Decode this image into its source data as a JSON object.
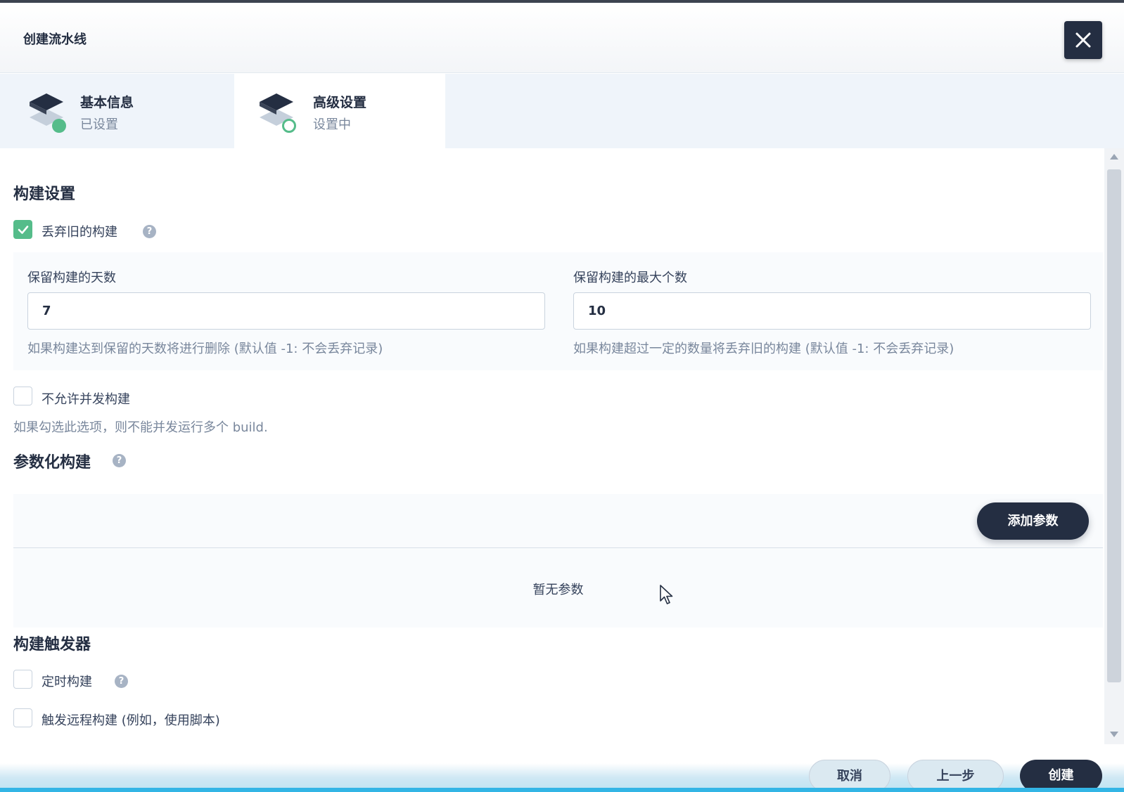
{
  "dialog": {
    "title": "创建流水线"
  },
  "steps": [
    {
      "title": "基本信息",
      "status": "已设置"
    },
    {
      "title": "高级设置",
      "status": "设置中"
    }
  ],
  "build_settings": {
    "title": "构建设置",
    "discard_old": {
      "label": "丢弃旧的构建",
      "checked": true
    },
    "days": {
      "label": "保留构建的天数",
      "value": "7",
      "hint": "如果构建达到保留的天数将进行删除 (默认值 -1: 不会丢弃记录)"
    },
    "max": {
      "label": "保留构建的最大个数",
      "value": "10",
      "hint": "如果构建超过一定的数量将丢弃旧的构建 (默认值 -1: 不会丢弃记录)"
    },
    "no_concurrent": {
      "label": "不允许并发构建",
      "checked": false,
      "desc": "如果勾选此选项，则不能并发运行多个 build."
    }
  },
  "params": {
    "title": "参数化构建",
    "add_label": "添加参数",
    "empty_text": "暂无参数"
  },
  "triggers": {
    "title": "构建触发器",
    "timed": {
      "label": "定时构建",
      "checked": false
    },
    "remote": {
      "label": "触发远程构建 (例如，使用脚本)",
      "checked": false
    }
  },
  "footer": {
    "cancel": "取消",
    "prev": "上一步",
    "create": "创建"
  },
  "colors": {
    "primary": "#242e42",
    "success": "#55bc8a",
    "muted": "#79879c"
  },
  "icons": {
    "help": "?"
  }
}
